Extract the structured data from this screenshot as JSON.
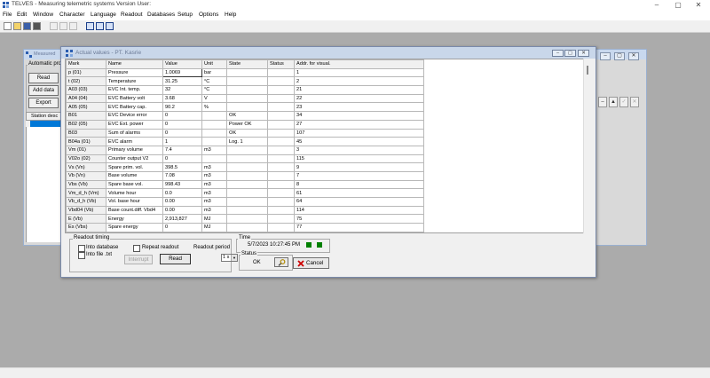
{
  "app": {
    "title": "TELVES - Measuring telemetric systems  Version User:",
    "window_controls": [
      "–",
      "▢",
      "✕"
    ]
  },
  "menu": [
    "File",
    "Edit",
    "Window",
    "Character",
    "Language",
    "Readout",
    "Databases",
    "Setup",
    "Options",
    "Help"
  ],
  "toolbar": {
    "icons": [
      "new-icon",
      "open-icon",
      "save-icon",
      "print-icon",
      "cut-icon",
      "copy-icon",
      "paste-icon",
      "tile-icon",
      "list-icon",
      "window-icon"
    ]
  },
  "bg_window": {
    "title": "Measured",
    "auto_group_label": "Automatic proc",
    "read_label": "Read",
    "add_data_label": "Add data",
    "export_label": "Export",
    "station_header": "Station desc",
    "right_buttons": [
      "–",
      "▲",
      "✓",
      "✕"
    ]
  },
  "actual_window": {
    "title": "Actual values - PT. Kasrie",
    "columns": [
      "Mark",
      "Name",
      "Value",
      "Unit",
      "State",
      "Status",
      "Addr. for visual."
    ],
    "rows": [
      {
        "mark": "p (01)",
        "name": "Pressure",
        "value": "1.0069",
        "unit": "bar",
        "state": "",
        "status": "",
        "addr": "1"
      },
      {
        "mark": "t (02)",
        "name": "Temperature",
        "value": "31.25",
        "unit": "°C",
        "state": "",
        "status": "",
        "addr": "2"
      },
      {
        "mark": "A03 (03)",
        "name": "EVC Int. temp.",
        "value": "32",
        "unit": "°C",
        "state": "",
        "status": "",
        "addr": "21"
      },
      {
        "mark": "A04 (04)",
        "name": "EVC Battery volt",
        "value": "3.68",
        "unit": "V",
        "state": "",
        "status": "",
        "addr": "22"
      },
      {
        "mark": "A05 (05)",
        "name": "EVC Battery cap.",
        "value": "90.2",
        "unit": "%",
        "state": "",
        "status": "",
        "addr": "23"
      },
      {
        "mark": "B01",
        "name": "EVC Device error",
        "value": "0",
        "unit": "",
        "state": "OK",
        "status": "",
        "addr": "34"
      },
      {
        "mark": "B02 (05)",
        "name": "EVC Ext. power",
        "value": "0",
        "unit": "",
        "state": "Power OK",
        "status": "",
        "addr": "27"
      },
      {
        "mark": "B03",
        "name": "Sum of alarms",
        "value": "0",
        "unit": "",
        "state": "OK",
        "status": "",
        "addr": "107"
      },
      {
        "mark": "B04a (01)",
        "name": "EVC alarm",
        "value": "1",
        "unit": "",
        "state": "Log. 1",
        "status": "",
        "addr": "45"
      },
      {
        "mark": "Vm (01)",
        "name": "Primary volume",
        "value": "7.4",
        "unit": "m3",
        "state": "",
        "status": "",
        "addr": "3"
      },
      {
        "mark": "V02o (02)",
        "name": "Counter output V2",
        "value": "0",
        "unit": "",
        "state": "",
        "status": "",
        "addr": "115"
      },
      {
        "mark": "Vs (Vn)",
        "name": "Spare prim. vol.",
        "value": "398.5",
        "unit": "m3",
        "state": "",
        "status": "",
        "addr": "9"
      },
      {
        "mark": "Vb (Vn)",
        "name": "Base volume",
        "value": "7.08",
        "unit": "m3",
        "state": "",
        "status": "",
        "addr": "7"
      },
      {
        "mark": "Vbs (Vb)",
        "name": "Spare base vol.",
        "value": "998.43",
        "unit": "m3",
        "state": "",
        "status": "",
        "addr": "8"
      },
      {
        "mark": "Vm_d_h (Vm)",
        "name": "Volume hour",
        "value": "0.0",
        "unit": "m3",
        "state": "",
        "status": "",
        "addr": "61"
      },
      {
        "mark": "Vb_d_h (Vb)",
        "name": "Vol. base hour",
        "value": "0.00",
        "unit": "m3",
        "state": "",
        "status": "",
        "addr": "64"
      },
      {
        "mark": "Vbd04 (Vb)",
        "name": "Base count.diff. Vbd4",
        "value": "0.00",
        "unit": "m3",
        "state": "",
        "status": "",
        "addr": "114"
      },
      {
        "mark": "E (Vb)",
        "name": "Energy",
        "value": "2,913,827",
        "unit": "MJ",
        "state": "",
        "status": "",
        "addr": "75"
      },
      {
        "mark": "Es (Vbs)",
        "name": "Spare energy",
        "value": "0",
        "unit": "MJ",
        "state": "",
        "status": "",
        "addr": "77"
      }
    ],
    "readout_timing": {
      "label": "Readout timing",
      "into_database": "Into database",
      "into_file": "Into file .txt",
      "repeat_readout": "Repeat readout",
      "readout_period": "Readout period",
      "period_value": "1 s",
      "interrupt": "Interrupt",
      "read": "Read"
    },
    "time": {
      "label": "Time",
      "value": "5/7/2023 10:27:45 PM",
      "indicator_color": "#008000"
    },
    "status": {
      "label": "Status",
      "value": "OK"
    },
    "cancel_label": "Cancel",
    "cancel_icon_color": "#cc0000"
  }
}
